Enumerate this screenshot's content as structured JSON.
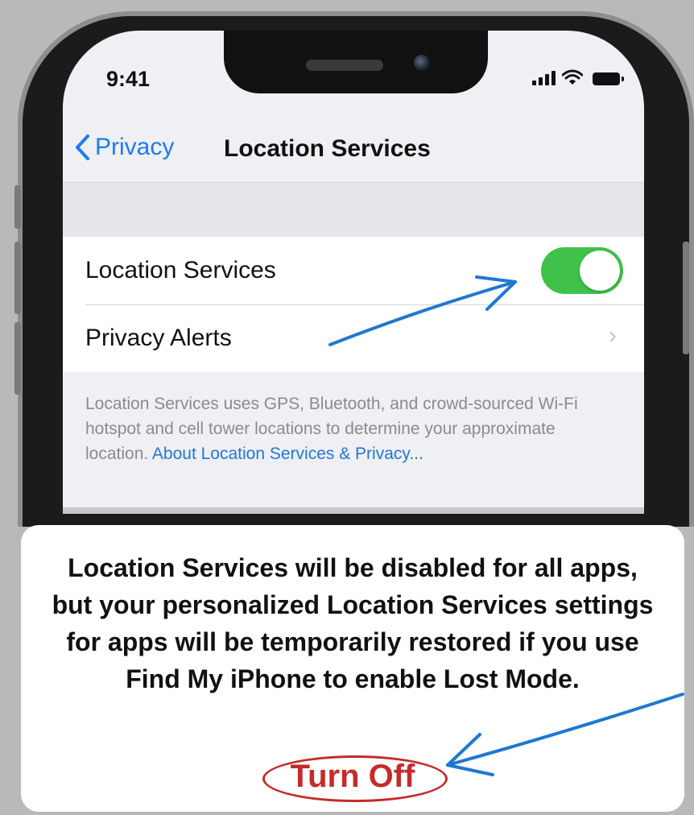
{
  "status_bar": {
    "time": "9:41",
    "icons": [
      "signal-icon",
      "wifi-icon",
      "battery-icon"
    ]
  },
  "nav": {
    "back_label": "Privacy",
    "back_icon": "chevron-left-icon",
    "title": "Location Services"
  },
  "settings": {
    "location_services": {
      "label": "Location Services",
      "toggle_on": true
    },
    "privacy_alerts": {
      "label": "Privacy Alerts",
      "icon": "chevron-right-icon"
    }
  },
  "footnote": {
    "text": "Location Services uses GPS, Bluetooth, and crowd-sourced Wi-Fi hotspot and cell tower locations to determine your approximate location. ",
    "link": "About Location Services & Privacy..."
  },
  "alert": {
    "message": "Location Services will be disabled for all apps, but your personalized Location Services settings for apps will be temporarily restored if you use Find My iPhone to enable Lost Mode.",
    "button_label": "Turn Off"
  },
  "colors": {
    "accent": "#1a7cf6",
    "toggle_on": "#3fc14a",
    "destructive": "#c62a2a",
    "annotation_arrow": "#1f78d1"
  }
}
